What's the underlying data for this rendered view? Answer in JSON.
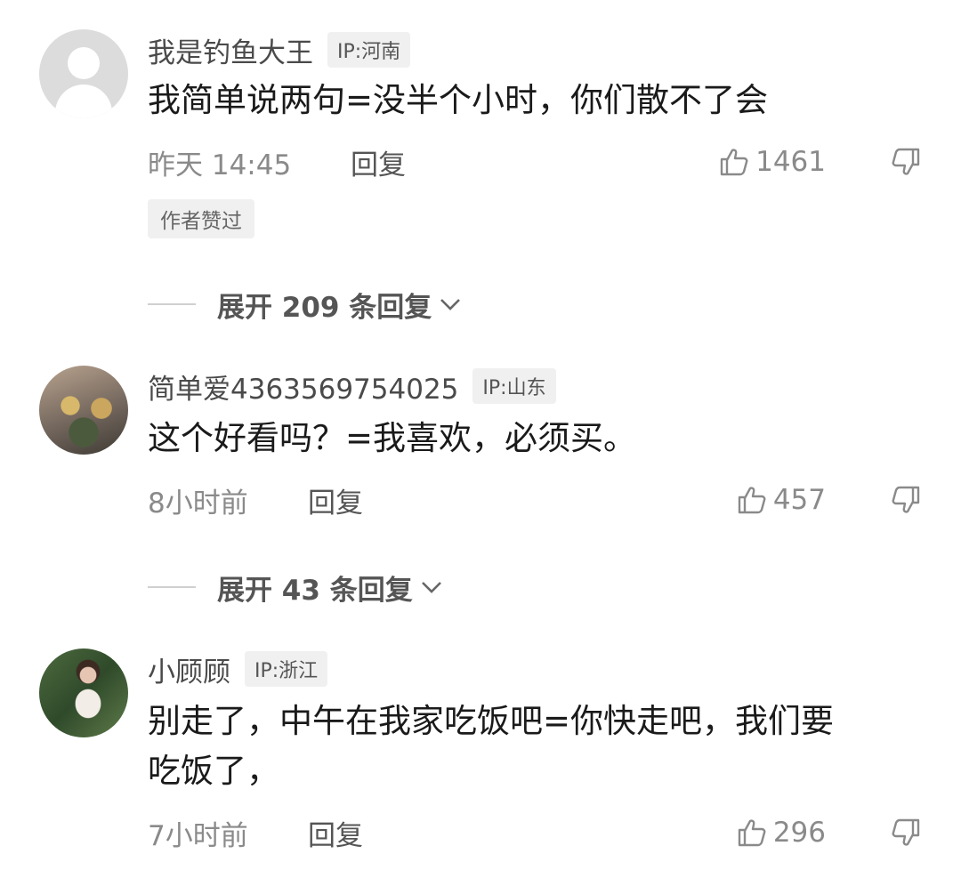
{
  "comments": [
    {
      "username": "我是钓鱼大王",
      "ip": "IP:河南",
      "text": "我简单说两句=没半个小时，你们散不了会",
      "time": "昨天 14:45",
      "reply": "回复",
      "likes": "1461",
      "author_badge": "作者赞过",
      "expand": "展开 209 条回复"
    },
    {
      "username": "简单爱4363569754025",
      "ip": "IP:山东",
      "text": "这个好看吗？=我喜欢，必须买。",
      "time": "8小时前",
      "reply": "回复",
      "likes": "457",
      "expand": "展开 43 条回复"
    },
    {
      "username": "小顾顾",
      "ip": "IP:浙江",
      "text_line1": "别走了，中午在我家吃饭吧=你快走吧，我们要",
      "text_line2": "吃饭了，",
      "time": "7小时前",
      "reply": "回复",
      "likes": "296"
    }
  ]
}
